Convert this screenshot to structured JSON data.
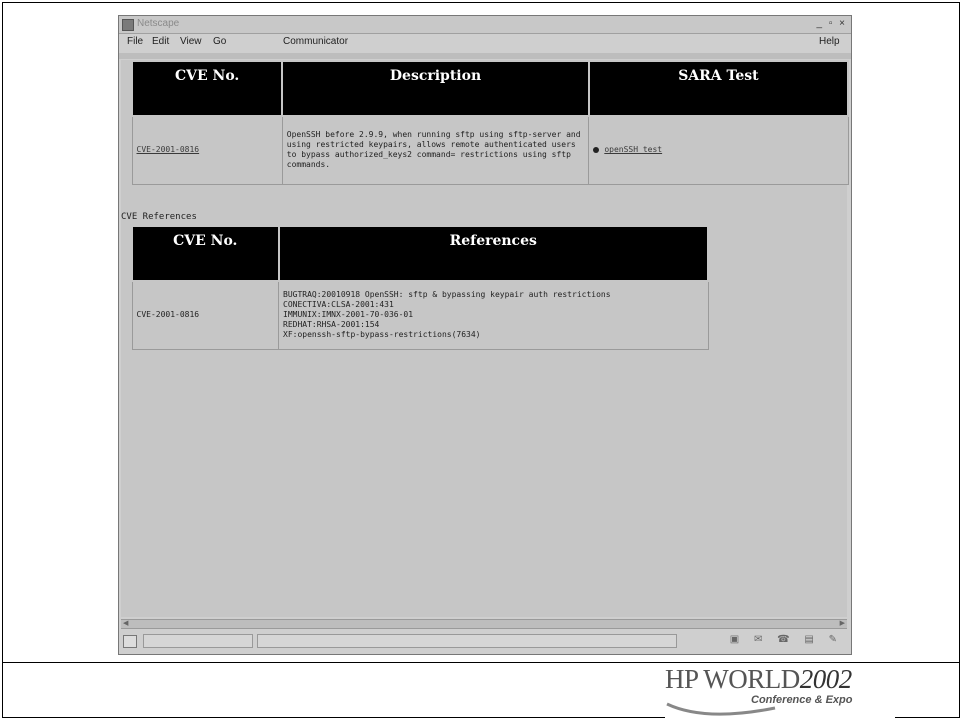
{
  "window": {
    "title": "Netscape",
    "controls": "_ ▫ ×",
    "menu": [
      "File",
      "Edit",
      "View",
      "Go",
      "Communicator"
    ],
    "help": "Help"
  },
  "sara_table": {
    "headers": [
      "CVE No.",
      "Description",
      "SARA Test"
    ],
    "row": {
      "cve": "CVE-2001-0816",
      "description": "OpenSSH before 2.9.9, when running sftp using sftp-server and using restricted keypairs, allows remote authenticated users to bypass authorized_keys2 command= restrictions using sftp commands.",
      "test": "openSSH test"
    }
  },
  "refs_label": "CVE References",
  "refs_table": {
    "headers": [
      "CVE No.",
      "References"
    ],
    "row": {
      "cve": "CVE-2001-0816",
      "references": [
        "BUGTRAQ:20010918 OpenSSH: sftp & bypassing keypair auth restrictions",
        "CONECTIVA:CLSA-2001:431",
        "IMMUNIX:IMNX-2001-70-036-01",
        "REDHAT:RHSA-2001:154",
        "XF:openssh-sftp-bypass-restrictions(7634)"
      ]
    }
  },
  "footer": {
    "logo_main": "HP WORLD",
    "logo_year": "2002",
    "logo_sub": "Conference & Expo"
  },
  "colors": {
    "header_bg": "#000000",
    "content_bg": "#c6c6c6"
  }
}
